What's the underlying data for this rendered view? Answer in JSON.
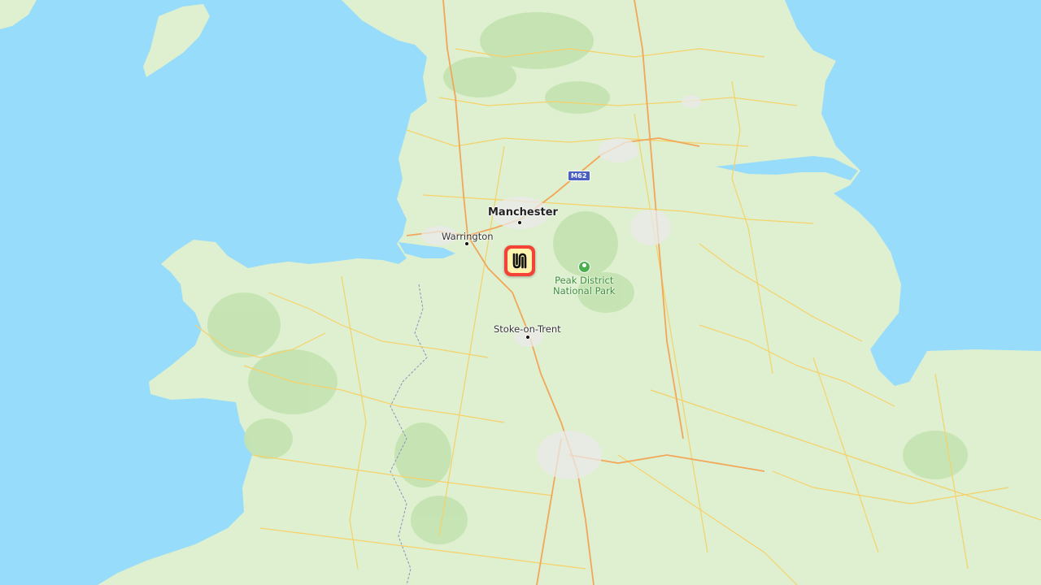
{
  "map": {
    "colors": {
      "water": "#97dcfb",
      "land": "#def0cf",
      "hills": "#c4e3b0",
      "motorway": "#f2a65a",
      "road": "#f6d16a"
    },
    "cities": {
      "manchester": "Manchester",
      "warrington": "Warrington",
      "stoke": "Stoke-on-Trent"
    },
    "park": {
      "line1": "Peak District",
      "line2": "National Park",
      "icon": "park-tree-icon"
    },
    "road_shield": "M62",
    "marker": {
      "icon": "brand-logo-icon",
      "color": "#f44336"
    }
  }
}
